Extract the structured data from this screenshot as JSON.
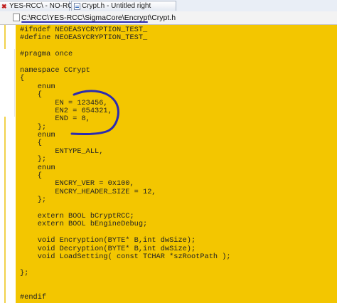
{
  "tabs": [
    {
      "label": "YES-RCC\\ - NO-RCC\\",
      "icon": "close-x-icon"
    },
    {
      "label": "Crypt.h - Untitled right",
      "icon": "file-icon"
    }
  ],
  "path": {
    "text": "C:\\RCC\\YES-RCC\\SigmaCore\\Encrypt\\Crypt.h",
    "icon": "file-icon"
  },
  "code_lines": [
    "#ifndef NEOEASYCRYPTION_TEST_",
    "#define NEOEASYCRYPTION_TEST_",
    "",
    "#pragma once",
    "",
    "namespace CCrypt",
    "{",
    "    enum",
    "    {",
    "        EN = 123456,",
    "        EN2 = 654321,",
    "        END = 8,",
    "    };",
    "    enum",
    "    {",
    "        ENTYPE_ALL,",
    "    };",
    "    enum",
    "    {",
    "        ENCRY_VER = 0x100,",
    "        ENCRY_HEADER_SIZE = 12,",
    "    };",
    "",
    "    extern BOOL bCryptRCC;",
    "    extern BOOL bEngineDebug;",
    "",
    "    void Encryption(BYTE* B,int dwSize);",
    "    void Decryption(BYTE* B,int dwSize);",
    "    void LoadSetting( const TCHAR *szRootPath );",
    "",
    "};",
    "",
    "",
    "#endif"
  ],
  "colors": {
    "editor_bg": "#f3c600",
    "annotation": "#2b2bb0"
  }
}
